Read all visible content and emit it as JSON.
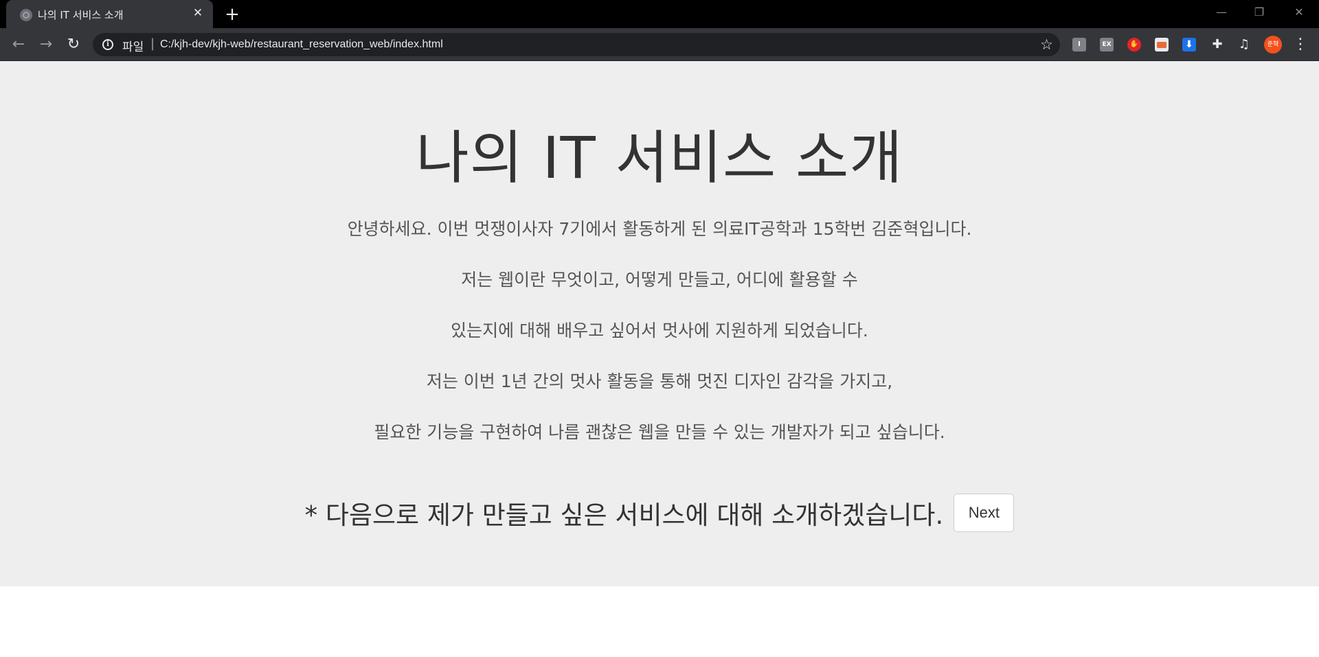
{
  "browser": {
    "tab_title": "나의 IT 서비스 소개",
    "tab_close": "✕",
    "new_tab": "+",
    "scheme_label": "파일",
    "url_separator": "|",
    "url": "C:/kjh-dev/kjh-web/restaurant_reservation_web/index.html",
    "extensions": [
      "I",
      "EX"
    ],
    "profile_initials": "준혁",
    "window_controls": [
      "—",
      "❐",
      "✕"
    ]
  },
  "page": {
    "headline": "나의 IT 서비스 소개",
    "intro_lines": [
      "안녕하세요. 이번 멋쟁이사자 7기에서 활동하게 된 의료IT공학과 15학번 김준혁입니다.",
      "저는 웹이란 무엇이고, 어떻게 만들고, 어디에 활용할 수",
      "있는지에 대해 배우고 싶어서 멋사에 지원하게 되었습니다.",
      "저는 이번 1년 간의 멋사 활동을 통해 멋진 디자인 감각을 가지고,",
      "필요한 기능을 구현하여 나름 괜찮은 웹을 만들 수 있는 개발자가 되고 싶습니다."
    ],
    "cta_text": "* 다음으로 제가 만들고 싶은 서비스에 대해 소개하겠습니다.",
    "next_label": "Next"
  },
  "colors": {
    "page_background": "#eeeeee",
    "heading_text": "#333333",
    "body_text": "#555555",
    "chrome_dark": "#35363a",
    "titlebar": "#000000"
  }
}
